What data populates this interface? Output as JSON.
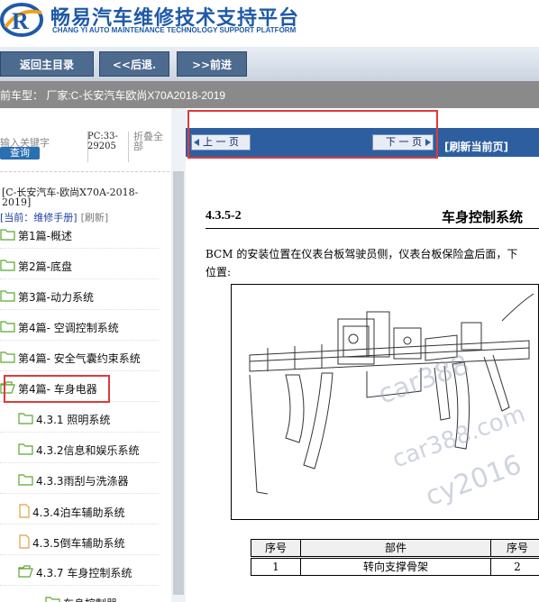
{
  "header": {
    "title": "畅易汽车维修技术支持平台",
    "subtitle": "CHANG YI AUTO MAINTENANCE TECHNOLOGY SUPPORT PLATFORM"
  },
  "nav": {
    "home": "返回主目录",
    "back": "<<后退.",
    "forward": ">>前进"
  },
  "model_bar": "前车型： 厂家:C-长安汽车欧尚X70A2018-2019",
  "sidebar": {
    "search_placeholder": "输入关键字",
    "search_button": "查询",
    "pc_label": "PC:33-29205",
    "collapse_label": "折叠全部",
    "root": "[C-长安汽车-欧尚X70A-2018-2019]",
    "current": "[当前：维修手册]",
    "refresh": "[刷新]",
    "items": [
      {
        "label": "第1篇-概述",
        "icon": "folder-icon"
      },
      {
        "label": "第2篇-底盘",
        "icon": "folder-icon"
      },
      {
        "label": "第3篇-动力系统",
        "icon": "folder-icon"
      },
      {
        "label": "第4篇- 空调控制系统",
        "icon": "folder-icon"
      },
      {
        "label": "第4篇- 安全气囊约束系统",
        "icon": "folder-icon"
      },
      {
        "label": "第4篇- 车身电器",
        "icon": "folder-open-icon"
      },
      {
        "label": "4.3.1 照明系统",
        "icon": "folder-icon"
      },
      {
        "label": "4.3.2信息和娱乐系统",
        "icon": "folder-icon"
      },
      {
        "label": "4.3.3雨刮与洗涤器",
        "icon": "folder-icon"
      },
      {
        "label": "4.3.4泊车辅助系统",
        "icon": "document-icon"
      },
      {
        "label": "4.3.5倒车辅助系统",
        "icon": "document-icon"
      },
      {
        "label": "4.3.7 车身控制系统",
        "icon": "folder-open-icon"
      },
      {
        "label": "车身控制器",
        "icon": "folder-icon"
      }
    ]
  },
  "toolbar": {
    "prev": "上 一 页",
    "next": "下 一 页",
    "refresh": "[刷新当前页]"
  },
  "doc": {
    "section_number": "4.3.5-2",
    "section_title": "车身控制系统",
    "paragraph_line1": "BCM 的安装位置在仪表台板驾驶员侧，仪表台板保险盒后面，下",
    "paragraph_line2": "位置:",
    "table": {
      "headers": [
        "序号",
        "部件",
        "序号"
      ],
      "rows": [
        [
          "1",
          "转向支撑骨架",
          "2"
        ]
      ]
    },
    "watermarks": [
      "car388",
      "car388.com",
      "cy2016"
    ]
  },
  "colors": {
    "brand_blue": "#1f5aa8",
    "nav_button": "#4d6a8f",
    "toolbar_blue": "#2d5fa0",
    "highlight_red": "#e03a3a"
  }
}
